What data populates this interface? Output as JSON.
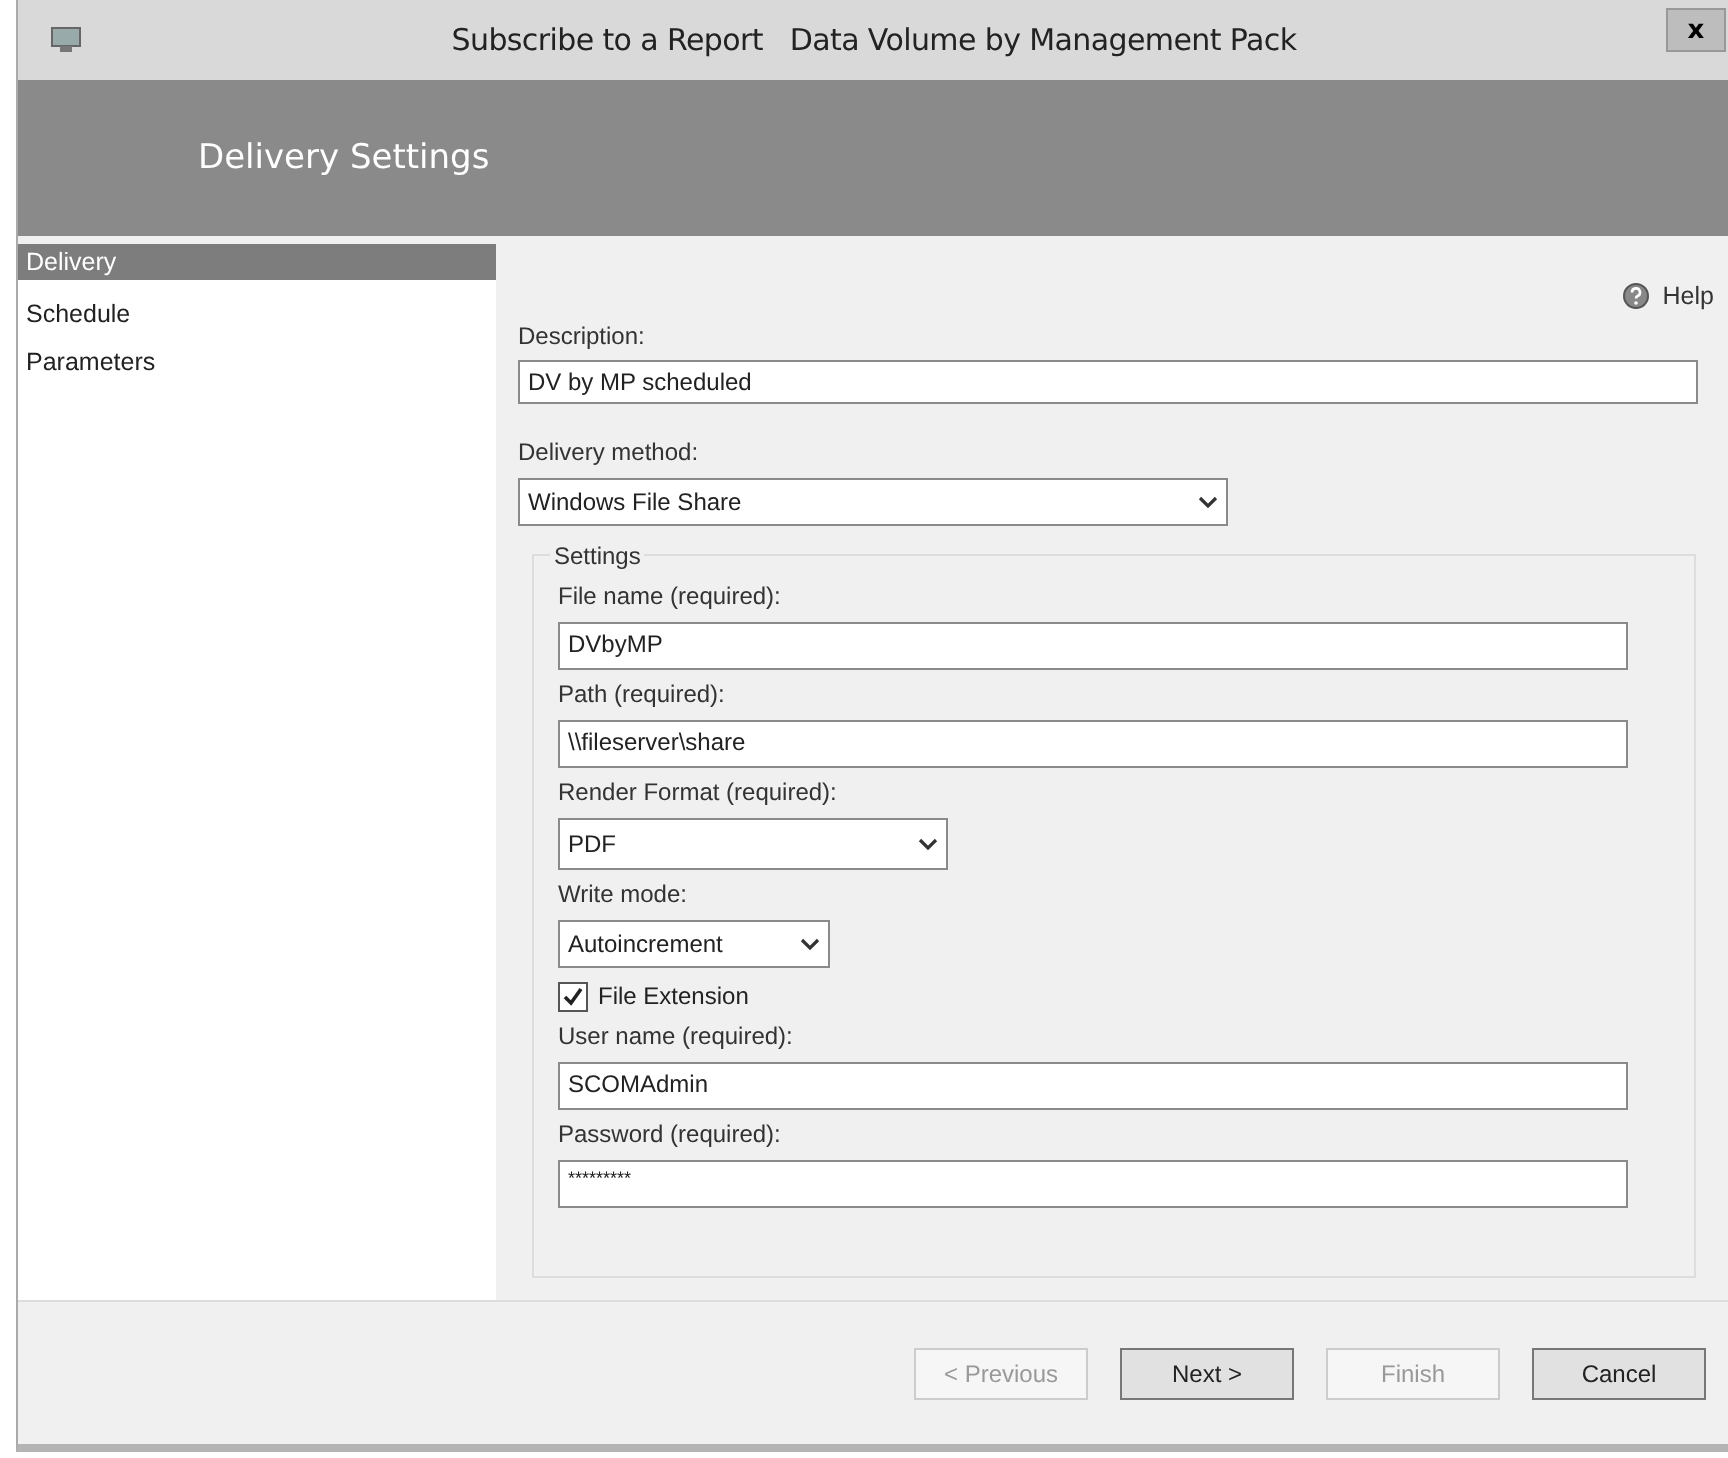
{
  "window": {
    "title": "Subscribe to a Report   Data Volume by Management Pack",
    "close": "x"
  },
  "header": {
    "title": "Delivery Settings"
  },
  "sidebar": {
    "items": [
      {
        "label": "Delivery",
        "selected": true
      },
      {
        "label": "Schedule",
        "selected": false
      },
      {
        "label": "Parameters",
        "selected": false
      }
    ]
  },
  "help": {
    "label": "Help"
  },
  "description": {
    "label": "Description:",
    "value": "DV by MP scheduled"
  },
  "delivery_method": {
    "label": "Delivery method:",
    "value": "Windows File Share"
  },
  "settings": {
    "title": "Settings",
    "fields": [
      {
        "kind": "text",
        "label": "File name (required):",
        "value": "DVbyMP"
      },
      {
        "kind": "text",
        "label": "Path (required):",
        "value": "\\\\fileserver\\share"
      },
      {
        "kind": "select",
        "label": "Render Format (required):",
        "value": "PDF"
      },
      {
        "kind": "select",
        "label": "Write mode:",
        "value": "Autoincrement"
      },
      {
        "kind": "checkbox",
        "label": "File Extension",
        "checked": true
      },
      {
        "kind": "text",
        "label": "User name (required):",
        "value": "SCOMAdmin"
      },
      {
        "kind": "password",
        "label": "Password (required):",
        "value": "*********"
      }
    ]
  },
  "buttons": [
    {
      "label": "< Previous",
      "disabled": true
    },
    {
      "label": "Next >",
      "disabled": false
    },
    {
      "label": "Finish",
      "disabled": true
    },
    {
      "label": "Cancel",
      "disabled": false
    }
  ]
}
